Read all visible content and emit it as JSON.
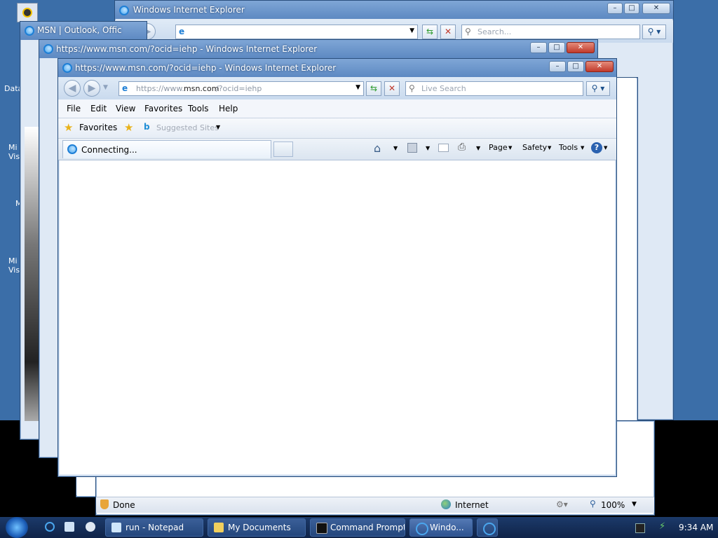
{
  "colors": {
    "desktop": "#3b6ea8",
    "titlebar": "#6e98cd",
    "taskbar": "#1c3a6a",
    "close": "#c0392b"
  },
  "desktop_icons": [
    {
      "label": "Data"
    },
    {
      "label": "Mi Vis"
    },
    {
      "label": "M"
    },
    {
      "label": "Mi Vis"
    }
  ],
  "back_window_top": {
    "title": "Windows Internet Explorer",
    "search_placeholder": "Search..."
  },
  "back_window_msn": {
    "title": "MSN | Outlook, Offic"
  },
  "back_window_mid": {
    "title": "https://www.msn.com/?ocid=iehp - Windows Internet Explorer"
  },
  "back_window_bottom": {
    "status_text": "Done",
    "zone": "Internet",
    "zoom": "100%"
  },
  "front_window": {
    "title": "https://www.msn.com/?ocid=iehp - Windows Internet Explorer",
    "address_prefix": "https://www.",
    "address_domain": "msn.com",
    "address_suffix": "/?ocid=iehp",
    "search_placeholder": "Live Search",
    "menu": [
      "File",
      "Edit",
      "View",
      "Favorites",
      "Tools",
      "Help"
    ],
    "favorites_label": "Favorites",
    "suggested_sites": "Suggested Sites",
    "tab_label": "Connecting...",
    "command_bar": {
      "page": "Page",
      "safety": "Safety",
      "tools": "Tools"
    }
  },
  "taskbar": {
    "buttons": [
      {
        "label": "run - Notepad"
      },
      {
        "label": "My Documents"
      },
      {
        "label": "Command Prompt"
      },
      {
        "label": "Windo..."
      }
    ],
    "clock": "9:34 AM"
  }
}
